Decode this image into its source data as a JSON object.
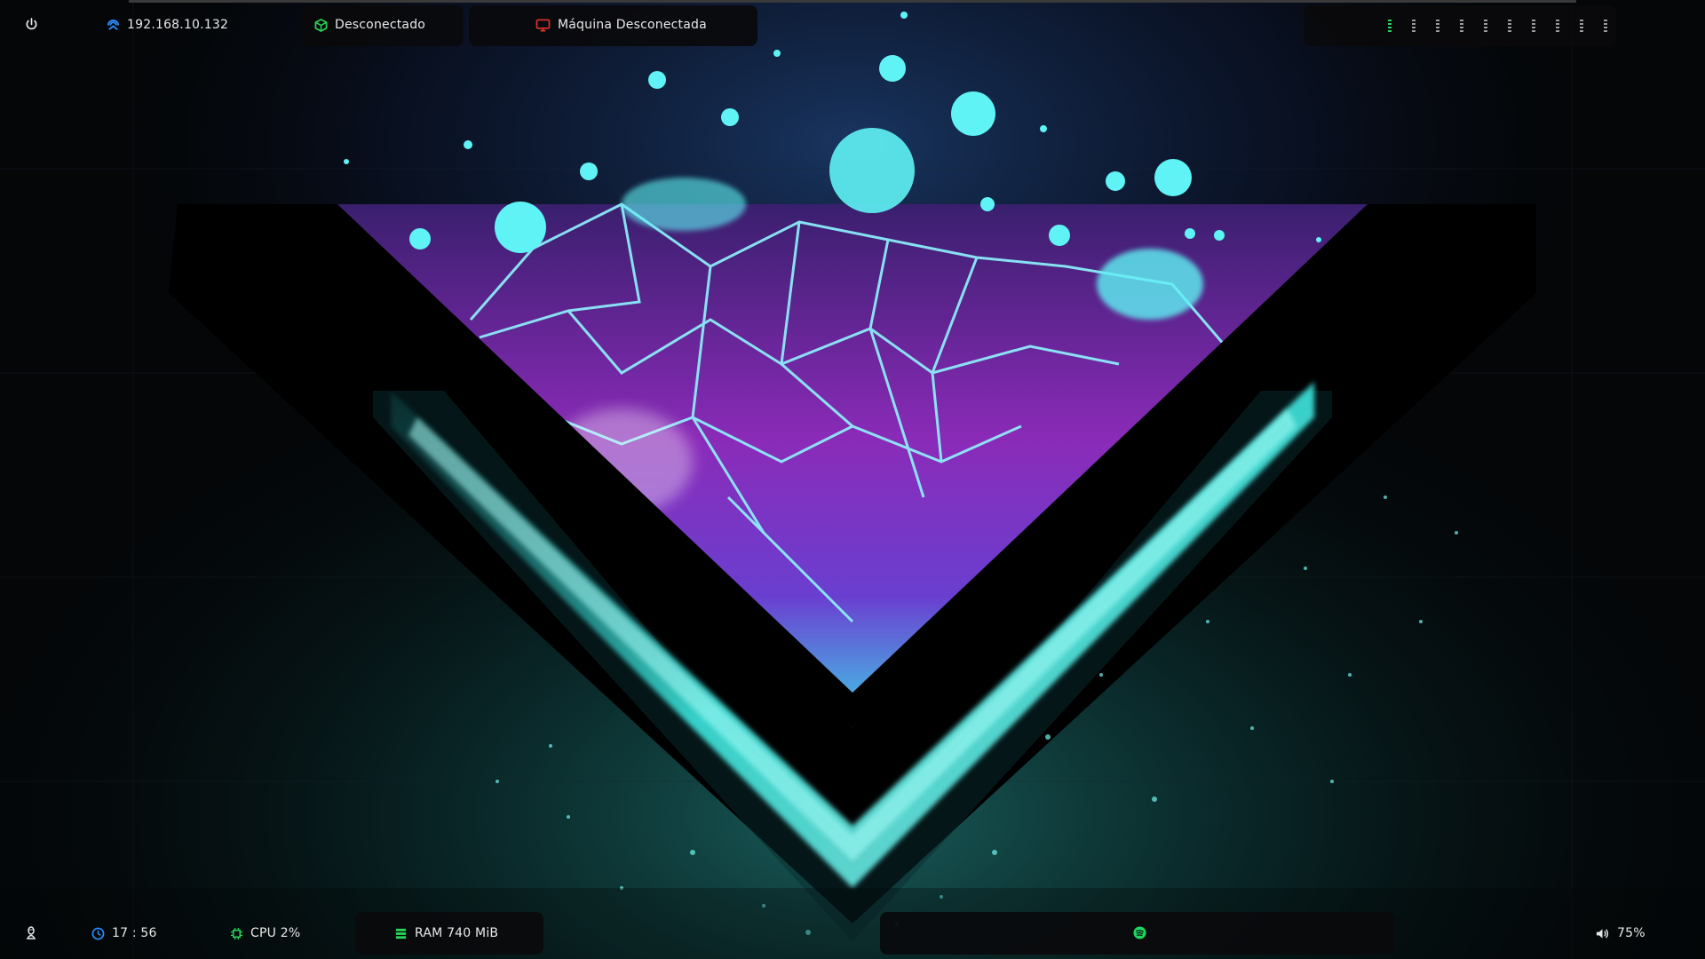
{
  "top_bar": {
    "ip_address": "192.168.10.132",
    "vpn_status": "Desconectado",
    "target_status": "Máquina Desconectada",
    "workspaces": [
      {
        "active": true
      },
      {
        "active": false
      },
      {
        "active": false
      },
      {
        "active": false
      },
      {
        "active": false
      },
      {
        "active": false
      },
      {
        "active": false
      },
      {
        "active": false
      },
      {
        "active": false
      },
      {
        "active": false
      }
    ]
  },
  "bottom_bar": {
    "time": "17 : 56",
    "cpu": "CPU 2%",
    "ram": "RAM 740 MiB",
    "volume": "75%"
  },
  "colors": {
    "ip_icon": "#2e8cff",
    "vpn_icon": "#27d65a",
    "target_icon": "#e0332b",
    "clock_icon": "#2e8cff",
    "cpu_icon": "#27d65a",
    "ram_icon": "#27d65a",
    "spotify_icon": "#1ed760",
    "active_workspace": "#2fd05a",
    "inactive_workspace": "#9a9a9a"
  },
  "icons": {
    "power": "power-icon",
    "ip": "network-icon",
    "vpn": "cube-icon",
    "target": "monitor-icon",
    "linux": "tux-icon",
    "clock": "clock-icon",
    "cpu": "cpu-icon",
    "ram": "memory-icon",
    "spotify": "spotify-icon",
    "volume": "volume-icon"
  }
}
